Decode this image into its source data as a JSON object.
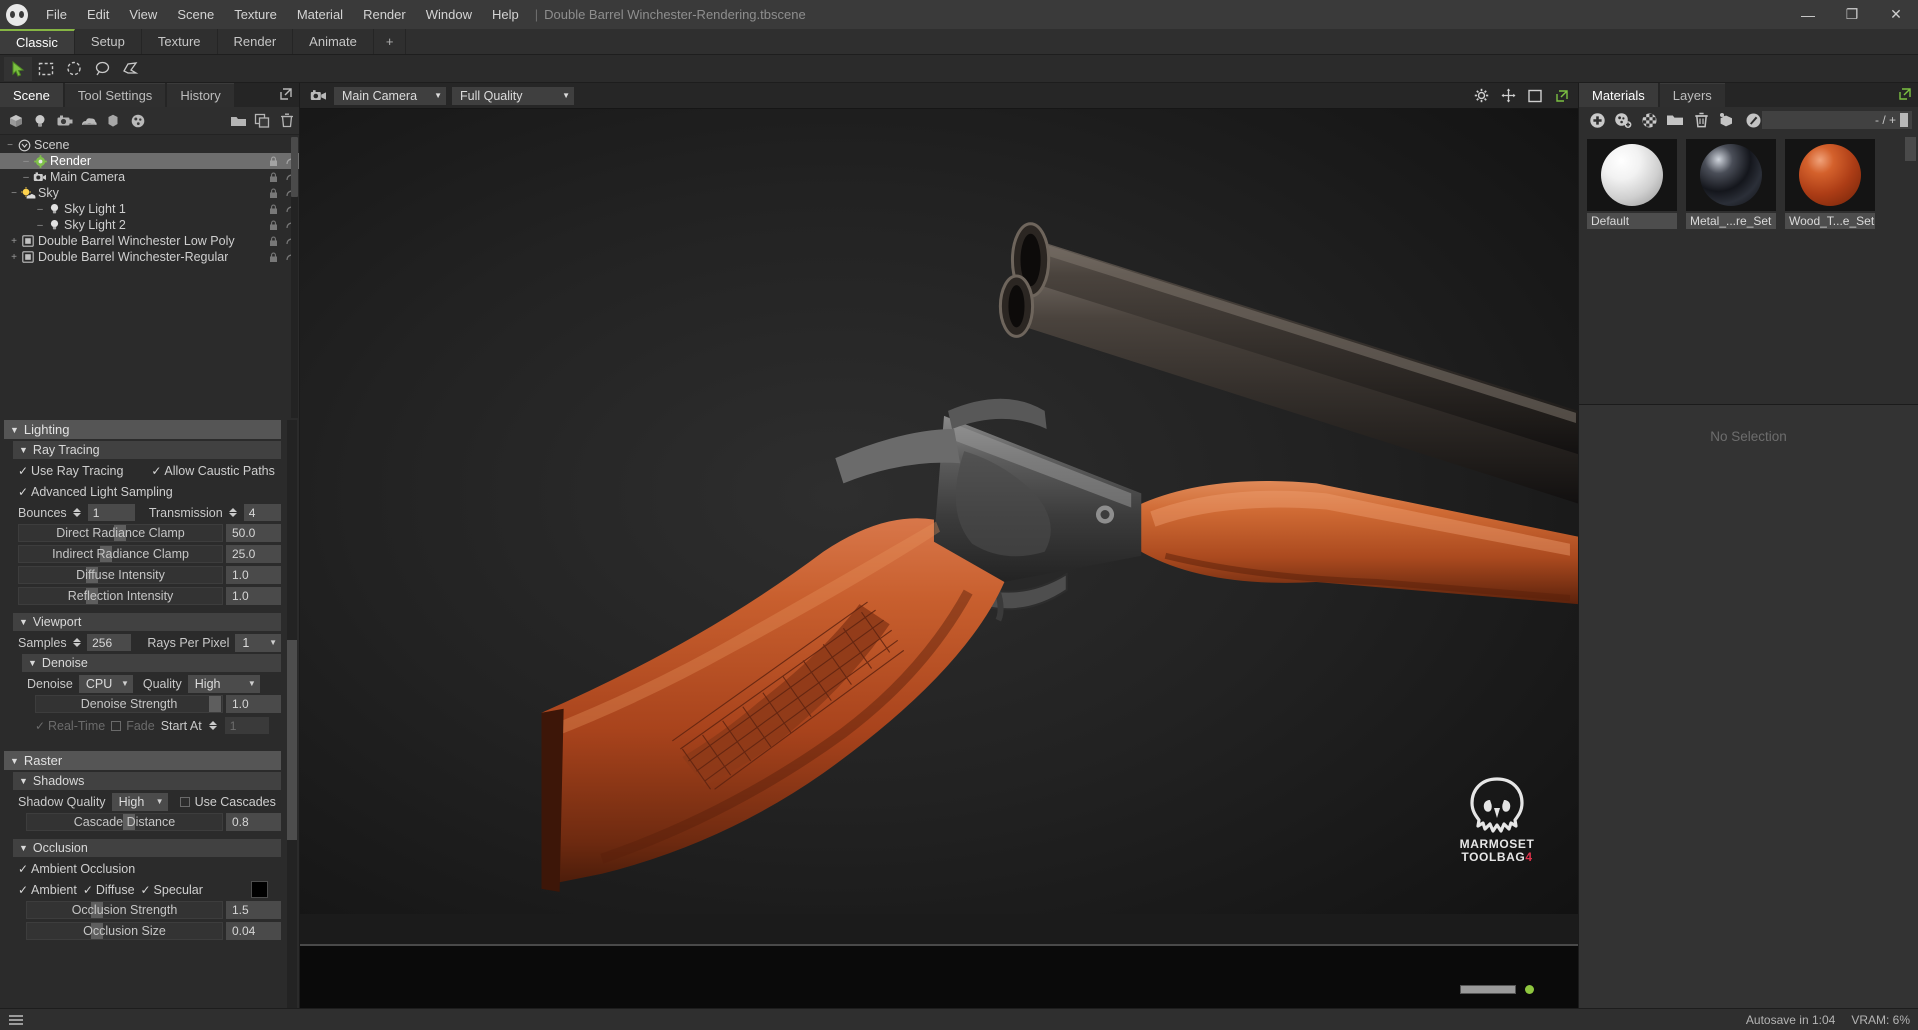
{
  "app": {
    "logo_icon": "marmoset-skull-icon",
    "document_title": "Double Barrel Winchester-Rendering.tbscene",
    "separator": "|",
    "menus": [
      "File",
      "Edit",
      "View",
      "Scene",
      "Texture",
      "Material",
      "Render",
      "Window",
      "Help"
    ],
    "window_controls": [
      {
        "name": "minimize-button",
        "glyph": "—"
      },
      {
        "name": "maximize-button",
        "glyph": "❐"
      },
      {
        "name": "close-button",
        "glyph": "✕"
      }
    ]
  },
  "layout_tabs": {
    "items": [
      "Classic",
      "Setup",
      "Texture",
      "Render",
      "Animate"
    ],
    "active": "Classic",
    "add_label": "+"
  },
  "select_tools": [
    {
      "name": "pointer-tool-icon",
      "active": true
    },
    {
      "name": "rectangle-marquee-tool-icon",
      "active": false
    },
    {
      "name": "ellipse-marquee-tool-icon",
      "active": false
    },
    {
      "name": "lasso-tool-icon",
      "active": false
    },
    {
      "name": "polygon-lasso-tool-icon",
      "active": false
    }
  ],
  "left_panel": {
    "tabs": [
      {
        "label": "Scene",
        "active": true
      },
      {
        "label": "Tool Settings",
        "active": false
      },
      {
        "label": "History",
        "active": false
      }
    ],
    "popout_icon": "popout-icon",
    "scene_toolbar": [
      {
        "name": "add-mesh-icon"
      },
      {
        "name": "add-light-icon"
      },
      {
        "name": "add-camera-icon"
      },
      {
        "name": "add-sky-icon"
      },
      {
        "name": "add-object-icon"
      },
      {
        "name": "add-material-icon"
      },
      {
        "name": "new-folder-icon"
      },
      {
        "name": "duplicate-icon"
      },
      {
        "name": "delete-icon"
      }
    ],
    "tree": [
      {
        "label": "Scene",
        "depth": 0,
        "icon": "scene-icon",
        "expander": "−",
        "selected": false,
        "controls": false
      },
      {
        "label": "Render",
        "depth": 1,
        "icon": "render-icon",
        "expander": "",
        "selected": true,
        "controls": true
      },
      {
        "label": "Main Camera",
        "depth": 1,
        "icon": "camera-icon",
        "expander": "",
        "selected": false,
        "controls": true
      },
      {
        "label": "Sky",
        "depth": 1,
        "icon": "sky-icon",
        "expander": "−",
        "selected": false,
        "controls": true
      },
      {
        "label": "Sky Light 1",
        "depth": 2,
        "icon": "light-icon",
        "expander": "",
        "selected": false,
        "controls": true
      },
      {
        "label": "Sky Light 2",
        "depth": 2,
        "icon": "light-icon",
        "expander": "",
        "selected": false,
        "controls": true
      },
      {
        "label": "Double Barrel Winchester Low Poly",
        "depth": 1,
        "icon": "mesh-icon",
        "expander": "+",
        "selected": false,
        "controls": true
      },
      {
        "label": "Double Barrel Winchester-Regular",
        "depth": 1,
        "icon": "mesh-icon",
        "expander": "+",
        "selected": false,
        "controls": true
      }
    ],
    "groups": {
      "lighting": {
        "title": "Lighting",
        "ray_tracing": {
          "title": "Ray Tracing",
          "use_ray_tracing": "Use Ray Tracing",
          "allow_caustic_paths": "Allow Caustic Paths",
          "advanced_light_sampling": "Advanced Light Sampling",
          "bounces_label": "Bounces",
          "bounces_value": "1",
          "transmission_label": "Transmission",
          "transmission_value": "4",
          "sliders": [
            {
              "label": "Direct Radiance Clamp",
              "value": "50.0",
              "fill": 0.47
            },
            {
              "label": "Indirect Radiance Clamp",
              "value": "25.0",
              "fill": 0.4
            },
            {
              "label": "Diffuse Intensity",
              "value": "1.0",
              "fill": 0.33
            },
            {
              "label": "Reflection Intensity",
              "value": "1.0",
              "fill": 0.33
            }
          ]
        },
        "viewport": {
          "title": "Viewport",
          "samples_label": "Samples",
          "samples_value": "256",
          "rays_label": "Rays Per Pixel",
          "rays_value": "1",
          "denoise": {
            "title": "Denoise",
            "denoise_label": "Denoise",
            "denoise_value": "CPU",
            "quality_label": "Quality",
            "quality_value": "High",
            "strength_label": "Denoise Strength",
            "strength_value": "1.0",
            "strength_fill": 0.93,
            "realtime_label": "Real-Time",
            "fade_label": "Fade",
            "startat_label": "Start At",
            "startat_value": "1"
          }
        }
      },
      "raster": {
        "title": "Raster",
        "shadows": {
          "title": "Shadows",
          "shadow_quality_label": "Shadow Quality",
          "shadow_quality_value": "High",
          "use_cascades_label": "Use Cascades",
          "cascade_distance_label": "Cascade Distance",
          "cascade_distance_value": "0.8",
          "cascade_fill": 0.49
        },
        "occlusion": {
          "title": "Occlusion",
          "ambient_occlusion_label": "Ambient Occlusion",
          "ambient_label": "Ambient",
          "diffuse_label": "Diffuse",
          "specular_label": "Specular",
          "color_swatch": "#000000",
          "strength_label": "Occlusion Strength",
          "strength_value": "1.5",
          "strength_fill": 0.33,
          "size_label": "Occlusion Size",
          "size_value": "0.04",
          "size_fill": 0.33
        }
      }
    }
  },
  "viewport": {
    "camera_icon": "camera-icon",
    "camera_value": "Main Camera",
    "quality_value": "Full Quality",
    "toolbar_icons": [
      {
        "name": "settings-gear-icon"
      },
      {
        "name": "move-gizmo-icon"
      },
      {
        "name": "framing-icon"
      },
      {
        "name": "popout-icon"
      }
    ],
    "watermark": {
      "line1": "MARMOSET",
      "line2": "TOOLBAG",
      "version": "4"
    },
    "progress_percent": 100,
    "status_dot_color": "#8ec63f"
  },
  "right_panel": {
    "tabs": [
      {
        "label": "Materials",
        "active": true
      },
      {
        "label": "Layers",
        "active": false
      }
    ],
    "popout_icon": "popout-icon",
    "toolbar": [
      {
        "name": "add-material-icon"
      },
      {
        "name": "duplicate-material-icon"
      },
      {
        "name": "clear-material-icon"
      },
      {
        "name": "folder-icon"
      },
      {
        "name": "delete-material-icon"
      },
      {
        "name": "assign-material-icon"
      },
      {
        "name": "paint-material-icon"
      },
      {
        "name": "pick-material-icon"
      }
    ],
    "count_text": "- / +",
    "materials": [
      {
        "name": "Default",
        "preview": "default"
      },
      {
        "name": "Metal_...re_Set",
        "preview": "metal"
      },
      {
        "name": "Wood_T...e_Set",
        "preview": "wood"
      }
    ],
    "selection_placeholder": "No Selection"
  },
  "statusbar": {
    "menu_icon": "hamburger-icon",
    "autosave": "Autosave in 1:04",
    "vram": "VRAM: 6%"
  }
}
